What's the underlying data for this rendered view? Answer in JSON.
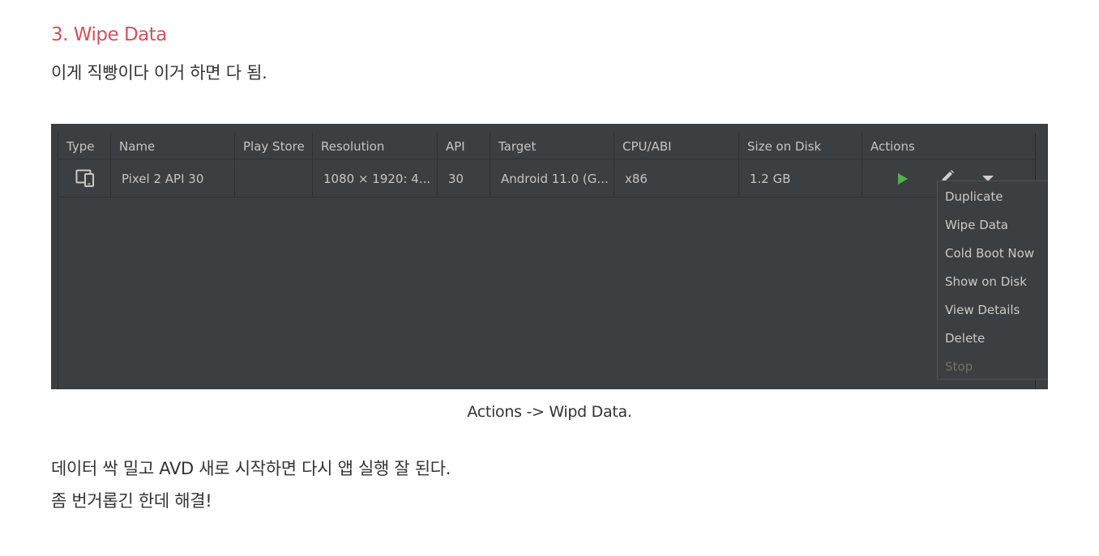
{
  "post": {
    "heading": "3. Wipe Data",
    "paragraph1": "이게 직빵이다 이거 하면 다 됨.",
    "caption": "Actions -> Wipd Data.",
    "paragraph2": "데이터 싹 밀고 AVD 새로 시작하면 다시 앱 실행 잘 된다.",
    "paragraph3": "좀 번거롭긴 한데 해결!"
  },
  "avd_manager": {
    "columns": [
      "Type",
      "Name",
      "Play Store",
      "Resolution",
      "API",
      "Target",
      "CPU/ABI",
      "Size on Disk",
      "Actions"
    ],
    "rows": [
      {
        "type_icon": "phone-tablet-icon",
        "name": "Pixel 2 API 30",
        "play_store": "",
        "resolution": "1080 × 1920: 4...",
        "api": "30",
        "target": "Android 11.0 (G...",
        "cpu_abi": "x86",
        "size_on_disk": "1.2 GB",
        "actions": [
          "play-icon",
          "pencil-icon",
          "chevron-down-icon"
        ]
      }
    ],
    "menu": {
      "items": [
        "Duplicate",
        "Wipe Data",
        "Cold Boot Now",
        "Show on Disk",
        "View Details",
        "Delete",
        "Stop"
      ],
      "disabled": [
        "Stop"
      ]
    }
  },
  "colors": {
    "heading": "#d5505a",
    "panel_bg": "#3c3f41",
    "text_light": "#c4c4c4",
    "play_green": "#4fb447"
  }
}
